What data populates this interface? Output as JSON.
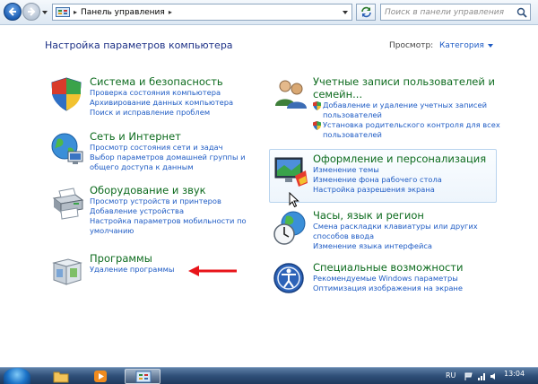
{
  "addressbar": {
    "breadcrumb": "Панель управления",
    "separator": "▸",
    "search_placeholder": "Поиск в панели управления"
  },
  "header": {
    "title": "Настройка параметров компьютера",
    "view_label": "Просмотр:",
    "view_value": "Категория"
  },
  "categories": {
    "system": {
      "title": "Система и безопасность",
      "links": [
        "Проверка состояния компьютера",
        "Архивирование данных компьютера",
        "Поиск и исправление проблем"
      ]
    },
    "network": {
      "title": "Сеть и Интернет",
      "links": [
        "Просмотр состояния сети и задач",
        "Выбор параметров домашней группы и",
        "общего доступа к данным"
      ]
    },
    "hardware": {
      "title": "Оборудование и звук",
      "links": [
        "Просмотр устройств и принтеров",
        "Добавление устройства",
        "Настройка параметров мобильности по",
        "умолчанию"
      ]
    },
    "programs": {
      "title": "Программы",
      "links": [
        "Удаление программы"
      ]
    },
    "accounts": {
      "title_line1": "Учетные записи пользователей и",
      "title_line2": "семейн...",
      "links": [
        "Добавление и удаление учетных записей",
        "пользователей",
        "Установка родительского контроля для всех",
        "пользователей"
      ]
    },
    "appearance": {
      "title": "Оформление и персонализация",
      "links": [
        "Изменение темы",
        "Изменение фона рабочего стола",
        "Настройка разрешения экрана"
      ]
    },
    "clock": {
      "title": "Часы, язык и регион",
      "links": [
        "Смена раскладки клавиатуры или других",
        "способов ввода",
        "Изменение языка интерфейса"
      ]
    },
    "access": {
      "title": "Специальные возможности",
      "links": [
        "Рекомендуемые Windows параметры",
        "Оптимизация изображения на экране"
      ]
    }
  },
  "taskbar": {
    "language": "RU",
    "time": "13:04"
  },
  "colors": {
    "category_title": "#0d6b1e",
    "link": "#1e5bc4",
    "page_title": "#1e3287",
    "annotation_arrow": "#e8141a"
  }
}
